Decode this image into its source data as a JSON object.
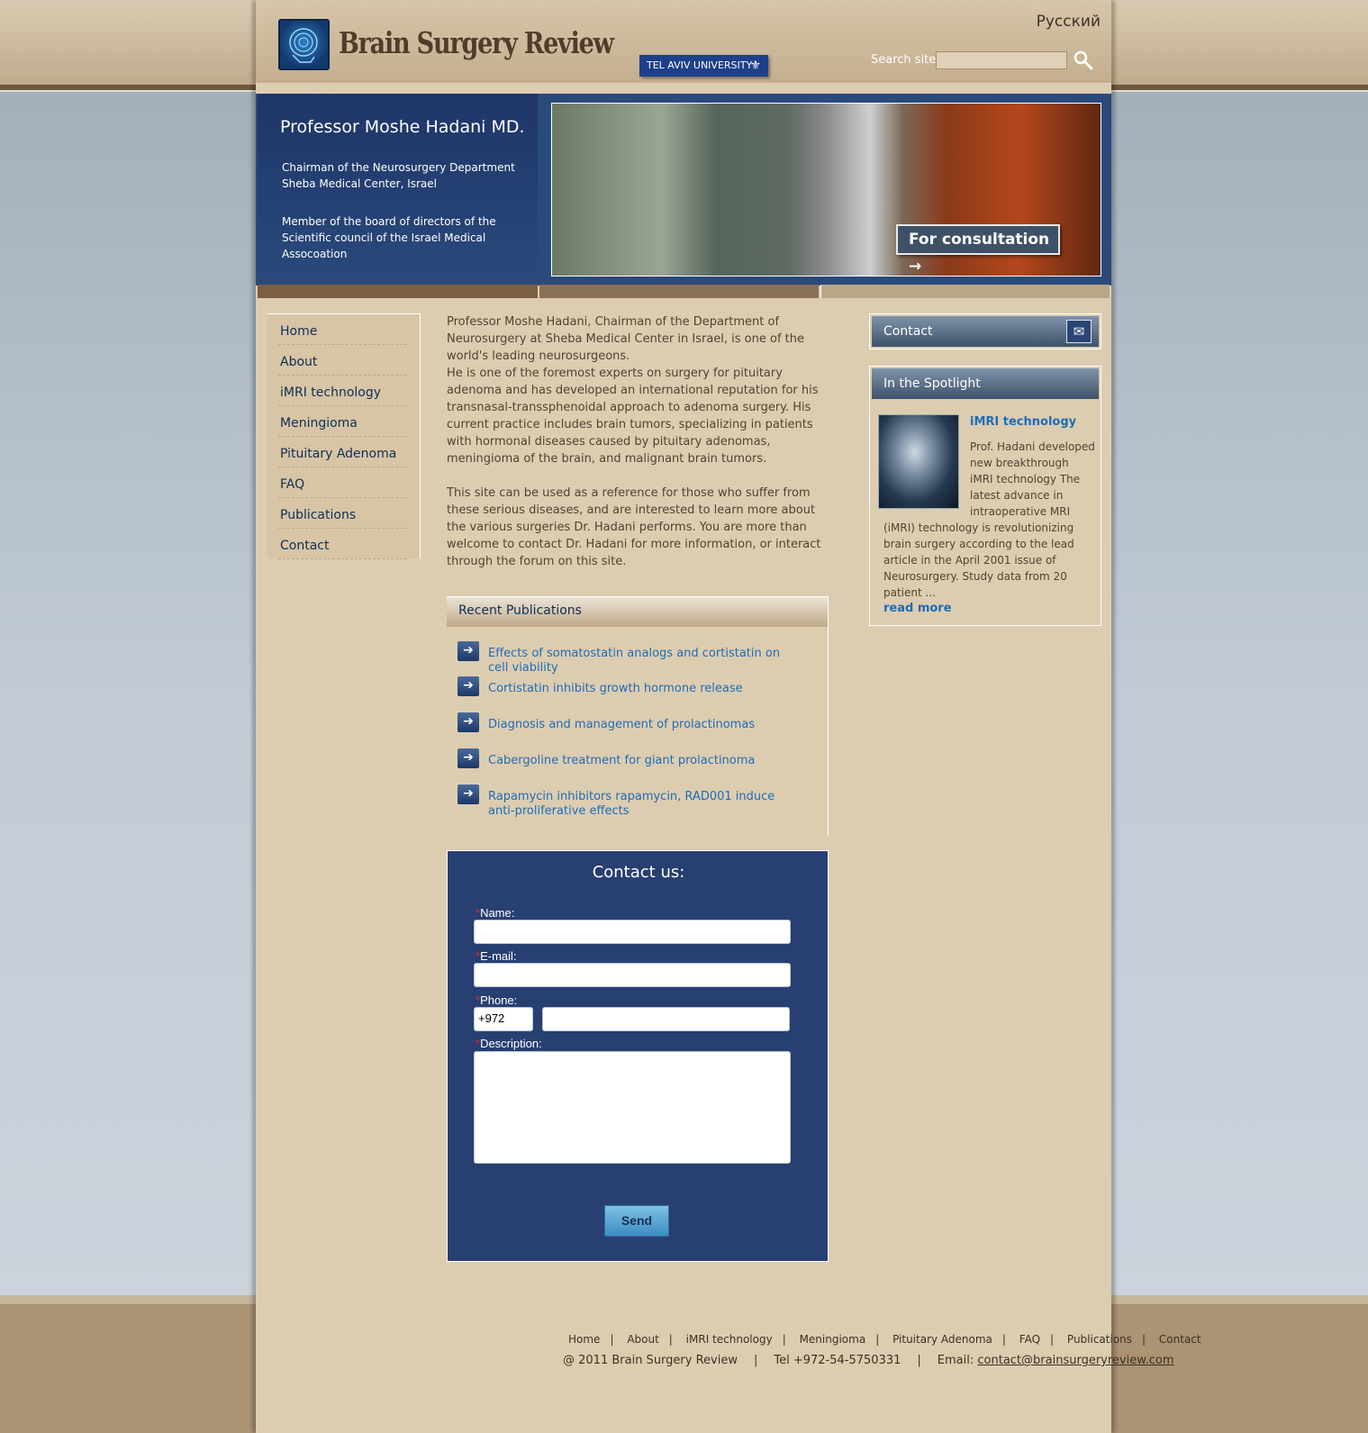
{
  "header": {
    "site_title": "Brain Surgery Review",
    "university_badge": "TEL AVIV UNIVERSITY",
    "language_link": "Русский",
    "search_label": "Search site",
    "search_placeholder": ""
  },
  "banner": {
    "name": "Professor Moshe Hadani MD.",
    "line1a": "Chairman of the Neurosurgery Department",
    "line1b": "Sheba Medical Center, Israel",
    "line2": "Member of the board of directors of the Scientific council of the Israel Medical Assocoation",
    "consult_button": "For consultation →"
  },
  "nav": {
    "items": [
      "Home",
      "About",
      "iMRI technology",
      "Meningioma",
      "Pituitary Adenoma",
      "FAQ",
      "Publications",
      "Contact"
    ]
  },
  "main": {
    "para1": "Professor Moshe Hadani, Chairman of the Department of Neurosurgery at Sheba Medical Center in Israel, is one of the world's leading neurosurgeons.",
    "para2": "He is one of the foremost experts on surgery for pituitary adenoma and has developed an international reputation for his transnasal-transsphenoidal approach to adenoma surgery. His current practice includes brain tumors, specializing in patients with hormonal diseases caused by pituitary adenomas, meningioma of the brain, and malignant brain tumors.",
    "para3": "This site can be used as a reference for those who suffer from these serious diseases, and are interested to learn more about the various surgeries Dr. Hadani performs. You are more than welcome to contact Dr. Hadani for more information, or interact through the forum on this site."
  },
  "publications": {
    "heading": "Recent Publications",
    "items": [
      "Effects of somatostatin analogs and cortistatin on cell viability",
      "Cortistatin inhibits growth hormone release",
      "Diagnosis and management of prolactinomas",
      "Cabergoline treatment for giant prolactinoma",
      "Rapamycin inhibitors rapamycin, RAD001 induce anti-proliferative effects"
    ]
  },
  "contact_form": {
    "title": "Contact us:",
    "name_label": "Name:",
    "email_label": "E-mail:",
    "phone_label": "Phone:",
    "phone_prefix": "+972",
    "description_label": "Description:",
    "required_mark": "*",
    "send_button": "Send"
  },
  "sidebar": {
    "contact_title": "Contact",
    "spotlight_title": "In the Spotlight",
    "spotlight_item_title": "iMRI technology",
    "spotlight_text": "Prof. Hadani developed new breakthrough iMRI technology The latest advance in intraoperative MRI (iMRI) technology is revolutionizing brain surgery according to the lead article in the April 2001 issue of Neurosurgery. Study data from 20 patient ...",
    "read_more": "read more"
  },
  "footer": {
    "links": [
      "Home",
      "About",
      "iMRI technology",
      "Meningioma",
      "Pituitary Adenoma",
      "FAQ",
      "Publications",
      "Contact"
    ],
    "separator": "|",
    "copyright": "@ 2011 Brain Surgery Review",
    "tel": "Tel +972-54-5750331",
    "email_label": "Email:",
    "email": "contact@brainsurgeryreview.com"
  },
  "icons": {
    "logo": "brain-logo-icon",
    "search": "search-icon",
    "pub_arrow": "arrow-right-icon",
    "mail": "mail-icon"
  }
}
